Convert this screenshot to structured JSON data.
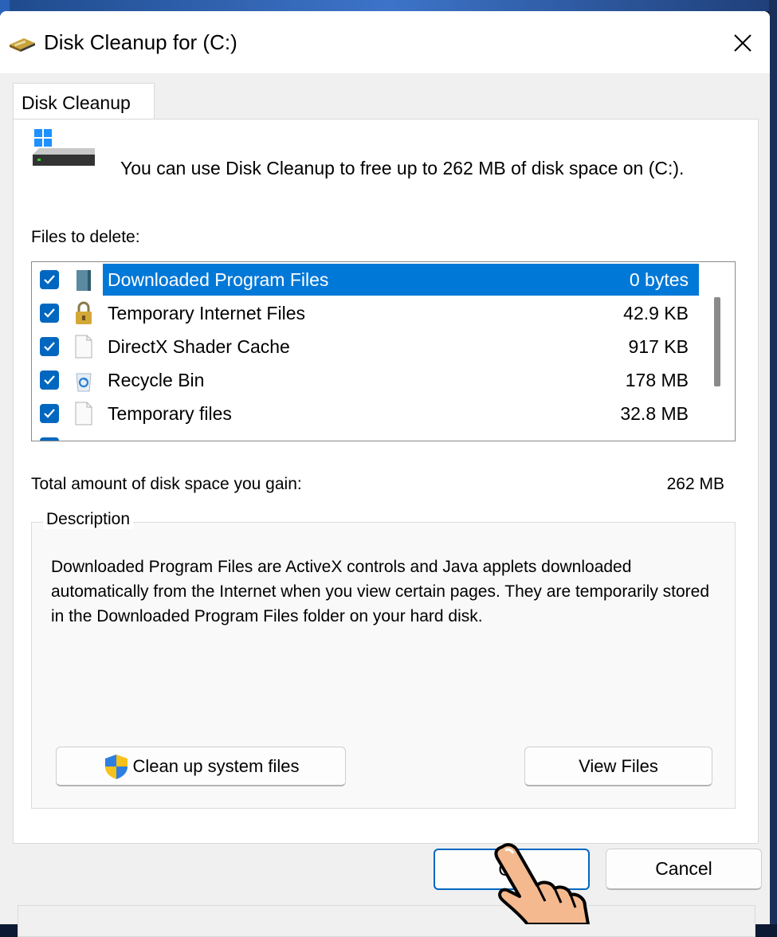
{
  "window": {
    "title": "Disk Cleanup for  (C:)",
    "close_label": "✕"
  },
  "tab": {
    "label": "Disk Cleanup"
  },
  "intro_text": "You can use Disk Cleanup to free up to 262 MB of disk space on (C:).",
  "files_label": "Files to delete:",
  "files": [
    {
      "name": "Downloaded Program Files",
      "size": "0 bytes",
      "checked": true,
      "selected": true,
      "icon": "folder-icon"
    },
    {
      "name": "Temporary Internet Files",
      "size": "42.9 KB",
      "checked": true,
      "selected": false,
      "icon": "lock-icon"
    },
    {
      "name": "DirectX Shader Cache",
      "size": "917 KB",
      "checked": true,
      "selected": false,
      "icon": "file-icon"
    },
    {
      "name": "Recycle Bin",
      "size": "178 MB",
      "checked": true,
      "selected": false,
      "icon": "recycle-bin-icon"
    },
    {
      "name": "Temporary files",
      "size": "32.8 MB",
      "checked": true,
      "selected": false,
      "icon": "file-icon"
    }
  ],
  "total": {
    "label": "Total amount of disk space you gain:",
    "value": "262 MB"
  },
  "description": {
    "legend": "Description",
    "text": "Downloaded Program Files are ActiveX controls and Java applets downloaded automatically from the Internet when you view certain pages. They are temporarily stored in the Downloaded Program Files folder on your hard disk."
  },
  "buttons": {
    "cleanup_system": "Clean up system files",
    "view_files": "View Files",
    "ok": "OK",
    "cancel": "Cancel"
  },
  "colors": {
    "accent": "#0078d7",
    "checkbox": "#0067c0"
  }
}
